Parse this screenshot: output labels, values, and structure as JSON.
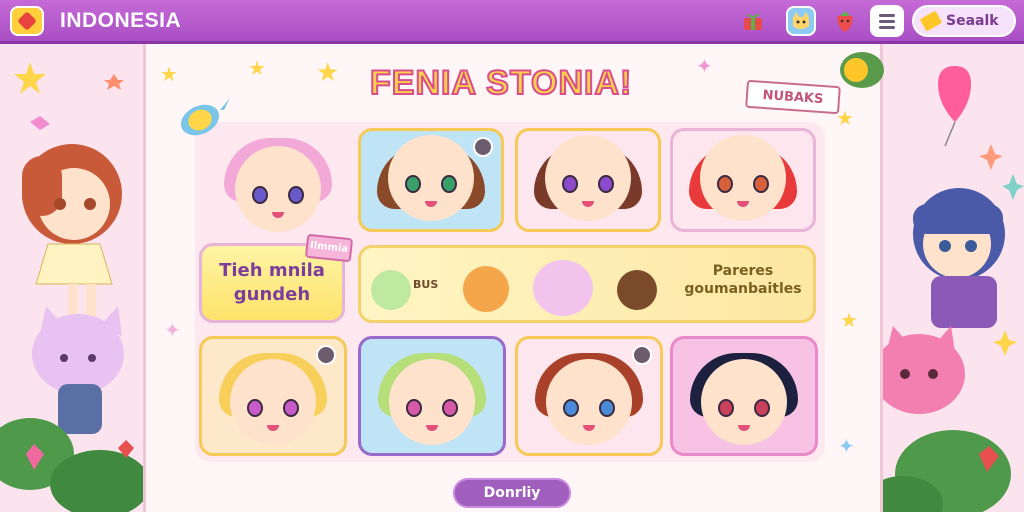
{
  "header": {
    "app_title": "INDONESIA",
    "search_label": "Seaalk",
    "icons": [
      "logo-diamond-icon",
      "gift-icon",
      "cat-face-icon",
      "strawberry-icon",
      "menu-icon",
      "tag-icon"
    ]
  },
  "main": {
    "game_title": "FENIA STONIA!",
    "sticker_label": "NUBAKS",
    "banner_left": {
      "line1": "Tieh mnila",
      "line2": "gundeh",
      "tag": "Ilmmia"
    },
    "banner_mid": {
      "label": "BUS",
      "promo_line1": "Pareres",
      "promo_line2": "goumanbaitles"
    },
    "primary_button": "Donrliy"
  },
  "colors": {
    "topbar": "#b45bcb",
    "panel": "#fff6f8",
    "accent_yellow": "#ffd24a",
    "accent_pink": "#d84d8e",
    "button": "#a05fbd"
  }
}
